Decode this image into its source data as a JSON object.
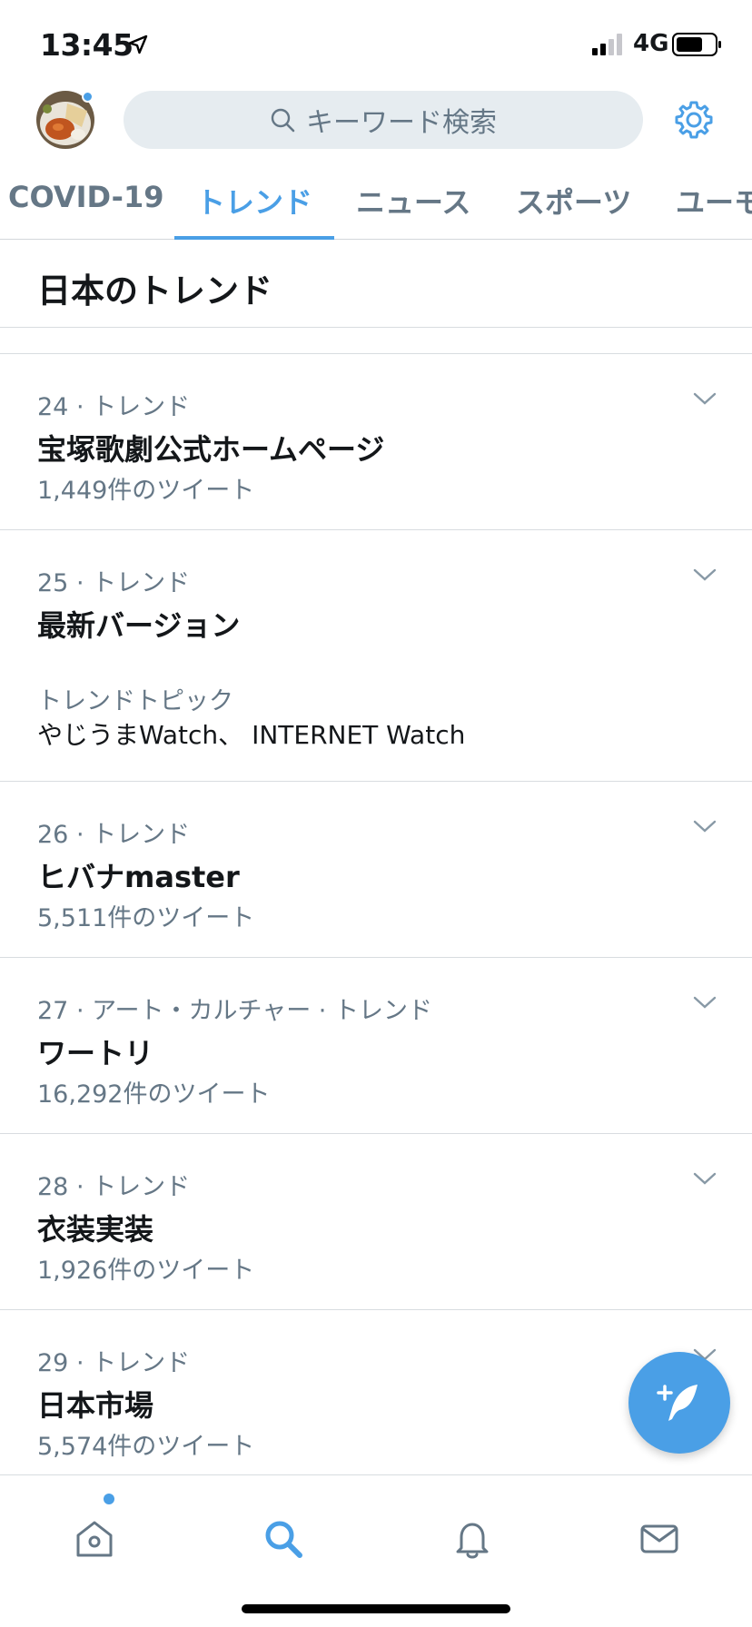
{
  "status_bar": {
    "time": "13:45",
    "network": "4G"
  },
  "header": {
    "search_placeholder": "キーワード検索"
  },
  "tabs": [
    {
      "label": "COVID-19",
      "active": false
    },
    {
      "label": "トレンド",
      "active": true
    },
    {
      "label": "ニュース",
      "active": false
    },
    {
      "label": "スポーツ",
      "active": false
    },
    {
      "label": "ユーモ",
      "active": false
    }
  ],
  "section_title": "日本のトレンド",
  "trends": [
    {
      "meta": "24 · トレンド",
      "name": "宝塚歌劇公式ホームページ",
      "count": "1,449件のツイート"
    },
    {
      "meta": "25 · トレンド",
      "name": "最新バージョン",
      "topic_label": "トレンドトピック",
      "topic_value": "やじうまWatch、 INTERNET Watch"
    },
    {
      "meta": "26 · トレンド",
      "name": "ヒバナmaster",
      "count": "5,511件のツイート"
    },
    {
      "meta": "27 · アート・カルチャー · トレンド",
      "name": "ワートリ",
      "count": "16,292件のツイート"
    },
    {
      "meta": "28 · トレンド",
      "name": "衣装実装",
      "count": "1,926件のツイート"
    },
    {
      "meta": "29 · トレンド",
      "name": "日本市場",
      "count": "5,574件のツイート"
    }
  ],
  "nav": [
    {
      "icon": "home-icon",
      "active": false,
      "has_dot": true
    },
    {
      "icon": "search-icon",
      "active": true
    },
    {
      "icon": "bell-icon",
      "active": false
    },
    {
      "icon": "mail-icon",
      "active": false
    }
  ],
  "colors": {
    "accent": "#4a9fe6",
    "secondary_text": "#657786",
    "search_bg": "#e6ecf0"
  }
}
